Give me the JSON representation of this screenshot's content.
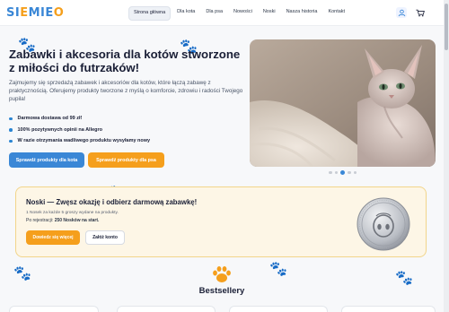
{
  "header": {
    "logo_text": "SIEMIEO",
    "nav": [
      {
        "label": "Strona główna",
        "active": true
      },
      {
        "label": "Dla kota",
        "active": false
      },
      {
        "label": "Dla psa",
        "active": false
      },
      {
        "label": "Nowości",
        "active": false
      },
      {
        "label": "Noski",
        "active": false
      },
      {
        "label": "Nasza historia",
        "active": false
      },
      {
        "label": "Kontakt",
        "active": false
      }
    ],
    "icons": [
      "user-icon",
      "cart-icon"
    ]
  },
  "hero": {
    "title": "Zabawki i akcesoria dla kotów stworzone z miłości do futrzaków!",
    "description": "Zajmujemy się sprzedażą zabawek i akcesoriów dla kotów, które łączą zabawę z praktycznością. Oferujemy produkty tworzone z myślą o komforcie, zdrowiu i radości Twojego pupila!",
    "features": [
      "Darmowa dostawa od 99 zł!",
      "100% pozytywnych opinii na Allegro",
      "W razie otrzymania wadliwego produktu wysyłamy nowy"
    ],
    "btn_cat": "Sprawdź produkty dla kota",
    "btn_dog": "Sprawdź produkty dla psa",
    "slides_total": 5,
    "slide_active": 2
  },
  "promo": {
    "title": "Noski — Zwęsz okazję i odbierz darmową zabawkę!",
    "subtitle": "1 Nosek za każde 5 groszy wydane na produkty.",
    "reg_label": "Po rejestracji:",
    "reg_value": "250 Nosków na start.",
    "btn_join": "Dowiedz się więcej",
    "btn_create": "Załóż konto"
  },
  "bestsellers": {
    "title": "Bestsellery"
  },
  "colors": {
    "brand_blue": "#3a87d6",
    "brand_orange": "#f59f1c",
    "promo_bg": "#fdf6e6"
  }
}
